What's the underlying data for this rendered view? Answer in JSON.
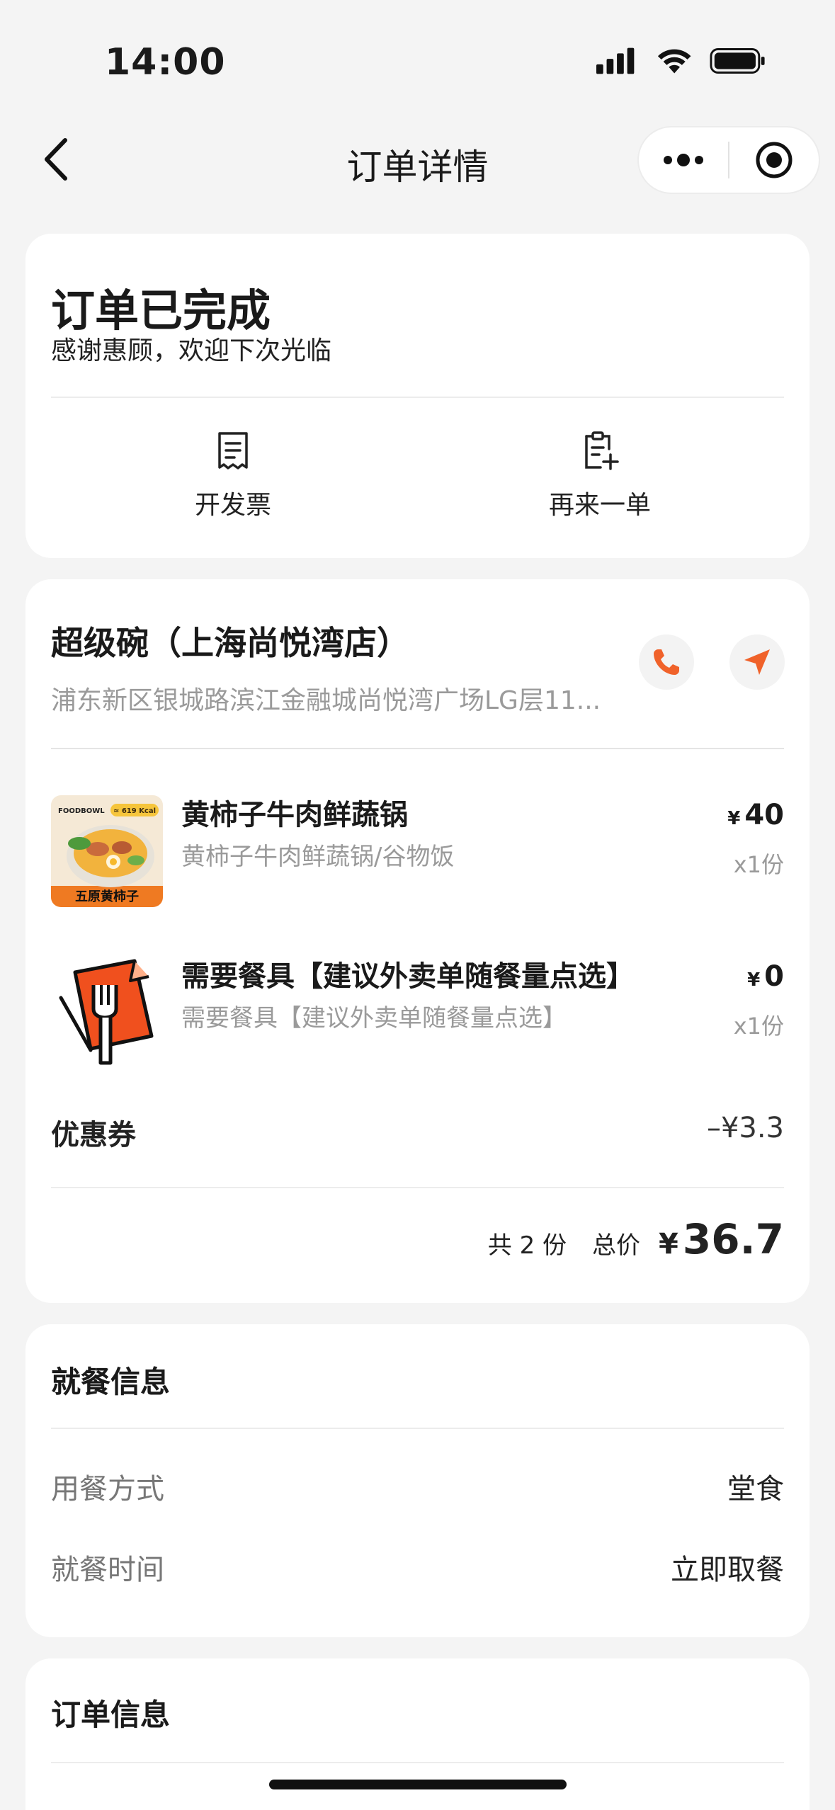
{
  "status_bar": {
    "time": "14:00"
  },
  "nav": {
    "title": "订单详情"
  },
  "order_status": {
    "title": "订单已完成",
    "subtitle": "感谢惠顾，欢迎下次光临",
    "actions": [
      {
        "label": "开发票",
        "icon": "receipt-icon"
      },
      {
        "label": "再来一单",
        "icon": "reorder-icon"
      }
    ]
  },
  "store": {
    "name": "超级碗（上海尚悦湾店）",
    "address": "浦东新区银城路滨江金融城尚悦湾广场LG层11...",
    "items": [
      {
        "name": "黄柿子牛肉鲜蔬锅",
        "desc": "黄柿子牛肉鲜蔬锅/谷物饭",
        "currency": "¥",
        "price": "40",
        "qty": "x1份",
        "image_brand": "FOODBOWL",
        "image_kcal": "≈ 619 Kcal",
        "image_caption": "五原黄柿子"
      },
      {
        "name": "需要餐具【建议外卖单随餐量点选】",
        "desc": "需要餐具【建议外卖单随餐量点选】",
        "currency": "¥",
        "price": "0",
        "qty": "x1份"
      }
    ],
    "coupon_label": "优惠券",
    "coupon_value": "–¥3.3",
    "total_count_text": "共 2 份",
    "total_label": "总价",
    "total_currency": "¥",
    "total_value": "36.7"
  },
  "dining": {
    "title": "就餐信息",
    "rows": [
      {
        "label": "用餐方式",
        "value": "堂食"
      },
      {
        "label": "就餐时间",
        "value": "立即取餐"
      }
    ]
  },
  "order_info": {
    "title": "订单信息"
  },
  "colors": {
    "accent": "#f0622a",
    "background": "#f4f4f4"
  }
}
